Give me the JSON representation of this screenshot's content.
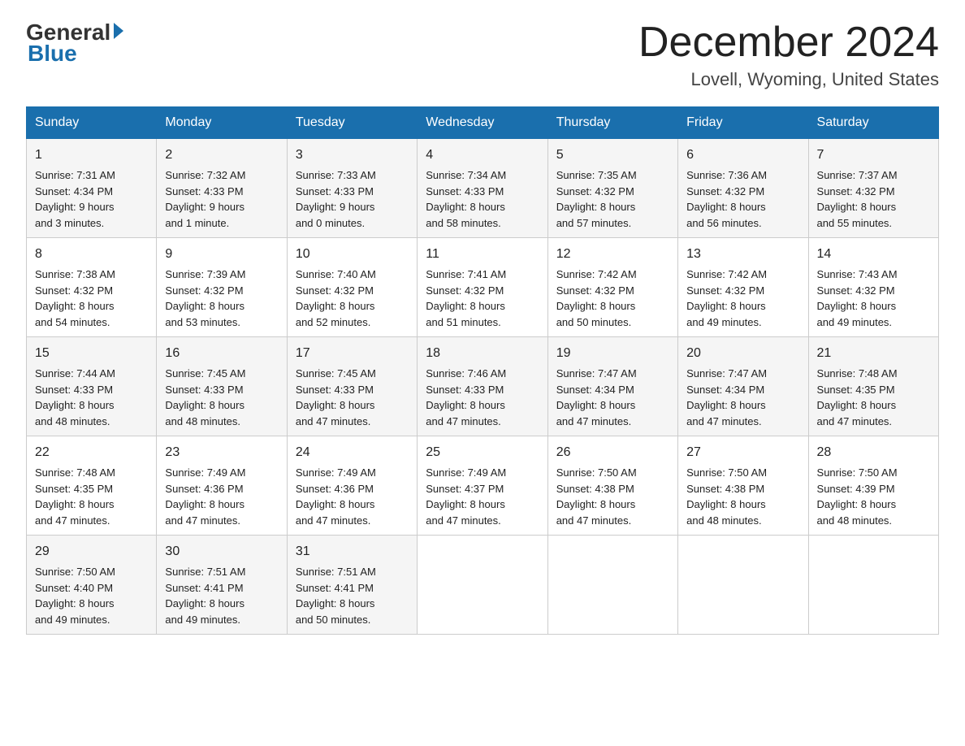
{
  "logo": {
    "general": "General",
    "blue": "Blue"
  },
  "title": "December 2024",
  "subtitle": "Lovell, Wyoming, United States",
  "days_of_week": [
    "Sunday",
    "Monday",
    "Tuesday",
    "Wednesday",
    "Thursday",
    "Friday",
    "Saturday"
  ],
  "weeks": [
    [
      {
        "day": "1",
        "sunrise": "7:31 AM",
        "sunset": "4:34 PM",
        "daylight": "9 hours and 3 minutes."
      },
      {
        "day": "2",
        "sunrise": "7:32 AM",
        "sunset": "4:33 PM",
        "daylight": "9 hours and 1 minute."
      },
      {
        "day": "3",
        "sunrise": "7:33 AM",
        "sunset": "4:33 PM",
        "daylight": "9 hours and 0 minutes."
      },
      {
        "day": "4",
        "sunrise": "7:34 AM",
        "sunset": "4:33 PM",
        "daylight": "8 hours and 58 minutes."
      },
      {
        "day": "5",
        "sunrise": "7:35 AM",
        "sunset": "4:32 PM",
        "daylight": "8 hours and 57 minutes."
      },
      {
        "day": "6",
        "sunrise": "7:36 AM",
        "sunset": "4:32 PM",
        "daylight": "8 hours and 56 minutes."
      },
      {
        "day": "7",
        "sunrise": "7:37 AM",
        "sunset": "4:32 PM",
        "daylight": "8 hours and 55 minutes."
      }
    ],
    [
      {
        "day": "8",
        "sunrise": "7:38 AM",
        "sunset": "4:32 PM",
        "daylight": "8 hours and 54 minutes."
      },
      {
        "day": "9",
        "sunrise": "7:39 AM",
        "sunset": "4:32 PM",
        "daylight": "8 hours and 53 minutes."
      },
      {
        "day": "10",
        "sunrise": "7:40 AM",
        "sunset": "4:32 PM",
        "daylight": "8 hours and 52 minutes."
      },
      {
        "day": "11",
        "sunrise": "7:41 AM",
        "sunset": "4:32 PM",
        "daylight": "8 hours and 51 minutes."
      },
      {
        "day": "12",
        "sunrise": "7:42 AM",
        "sunset": "4:32 PM",
        "daylight": "8 hours and 50 minutes."
      },
      {
        "day": "13",
        "sunrise": "7:42 AM",
        "sunset": "4:32 PM",
        "daylight": "8 hours and 49 minutes."
      },
      {
        "day": "14",
        "sunrise": "7:43 AM",
        "sunset": "4:32 PM",
        "daylight": "8 hours and 49 minutes."
      }
    ],
    [
      {
        "day": "15",
        "sunrise": "7:44 AM",
        "sunset": "4:33 PM",
        "daylight": "8 hours and 48 minutes."
      },
      {
        "day": "16",
        "sunrise": "7:45 AM",
        "sunset": "4:33 PM",
        "daylight": "8 hours and 48 minutes."
      },
      {
        "day": "17",
        "sunrise": "7:45 AM",
        "sunset": "4:33 PM",
        "daylight": "8 hours and 47 minutes."
      },
      {
        "day": "18",
        "sunrise": "7:46 AM",
        "sunset": "4:33 PM",
        "daylight": "8 hours and 47 minutes."
      },
      {
        "day": "19",
        "sunrise": "7:47 AM",
        "sunset": "4:34 PM",
        "daylight": "8 hours and 47 minutes."
      },
      {
        "day": "20",
        "sunrise": "7:47 AM",
        "sunset": "4:34 PM",
        "daylight": "8 hours and 47 minutes."
      },
      {
        "day": "21",
        "sunrise": "7:48 AM",
        "sunset": "4:35 PM",
        "daylight": "8 hours and 47 minutes."
      }
    ],
    [
      {
        "day": "22",
        "sunrise": "7:48 AM",
        "sunset": "4:35 PM",
        "daylight": "8 hours and 47 minutes."
      },
      {
        "day": "23",
        "sunrise": "7:49 AM",
        "sunset": "4:36 PM",
        "daylight": "8 hours and 47 minutes."
      },
      {
        "day": "24",
        "sunrise": "7:49 AM",
        "sunset": "4:36 PM",
        "daylight": "8 hours and 47 minutes."
      },
      {
        "day": "25",
        "sunrise": "7:49 AM",
        "sunset": "4:37 PM",
        "daylight": "8 hours and 47 minutes."
      },
      {
        "day": "26",
        "sunrise": "7:50 AM",
        "sunset": "4:38 PM",
        "daylight": "8 hours and 47 minutes."
      },
      {
        "day": "27",
        "sunrise": "7:50 AM",
        "sunset": "4:38 PM",
        "daylight": "8 hours and 48 minutes."
      },
      {
        "day": "28",
        "sunrise": "7:50 AM",
        "sunset": "4:39 PM",
        "daylight": "8 hours and 48 minutes."
      }
    ],
    [
      {
        "day": "29",
        "sunrise": "7:50 AM",
        "sunset": "4:40 PM",
        "daylight": "8 hours and 49 minutes."
      },
      {
        "day": "30",
        "sunrise": "7:51 AM",
        "sunset": "4:41 PM",
        "daylight": "8 hours and 49 minutes."
      },
      {
        "day": "31",
        "sunrise": "7:51 AM",
        "sunset": "4:41 PM",
        "daylight": "8 hours and 50 minutes."
      },
      null,
      null,
      null,
      null
    ]
  ],
  "labels": {
    "sunrise": "Sunrise:",
    "sunset": "Sunset:",
    "daylight": "Daylight:"
  }
}
